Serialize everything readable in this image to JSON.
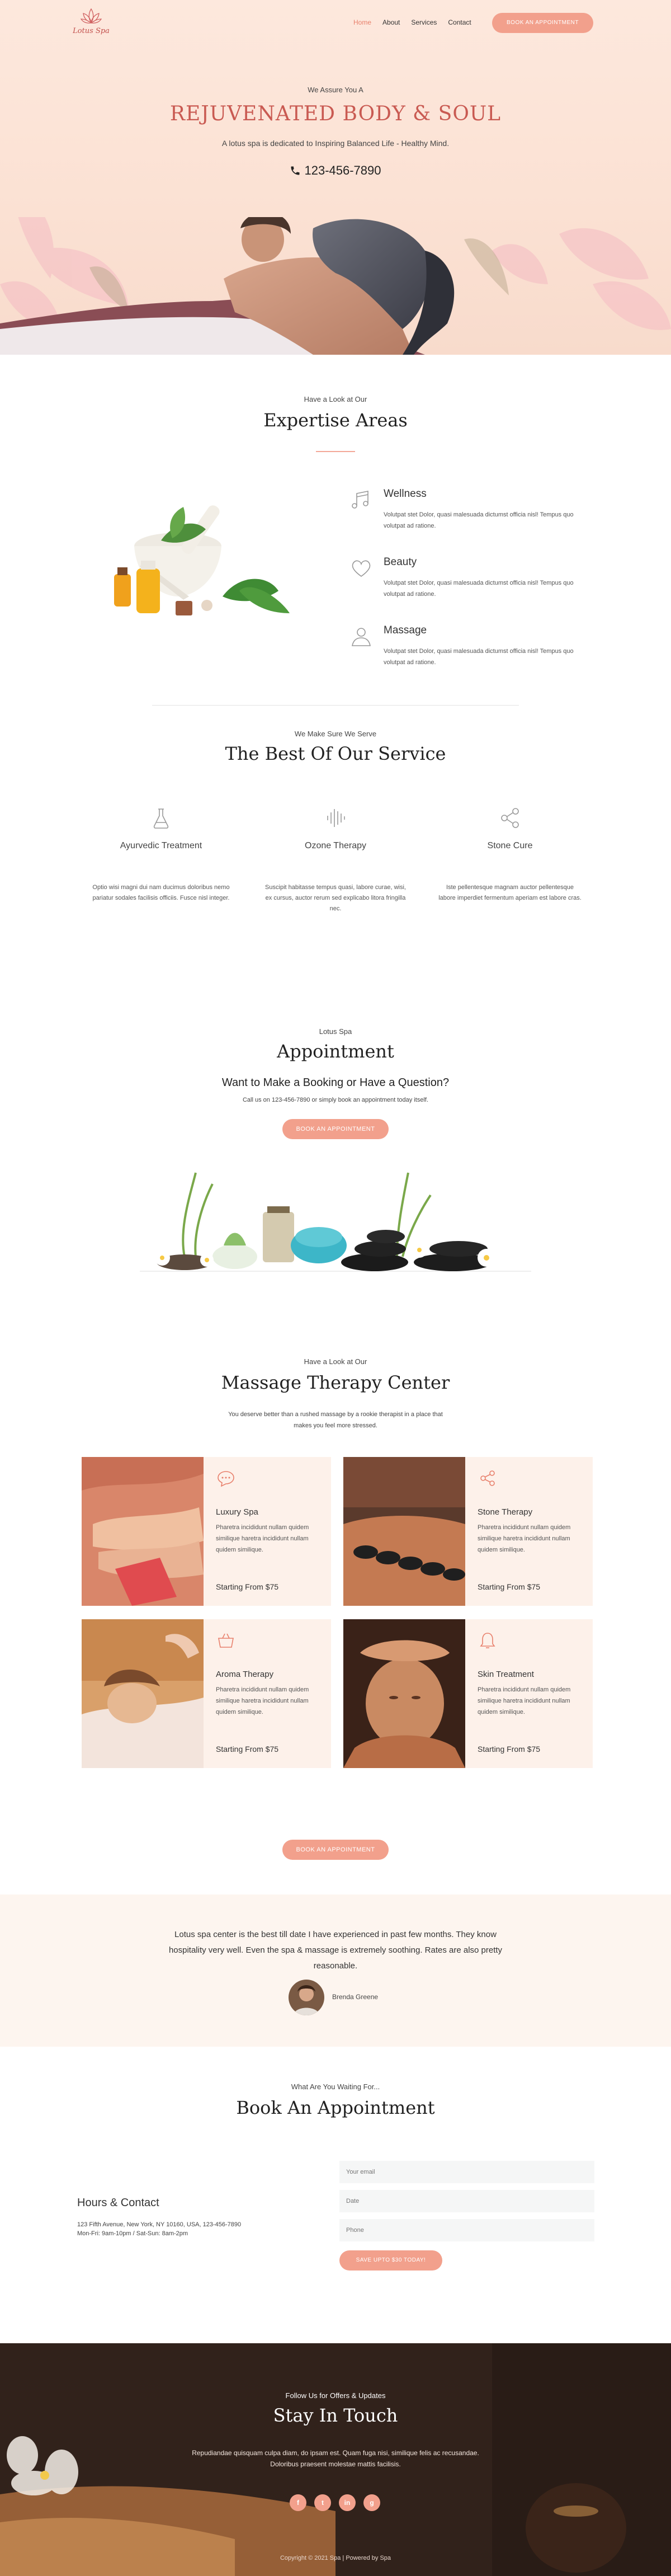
{
  "nav": {
    "logo_text": "Lotus Spa",
    "menu": [
      "Home",
      "About",
      "Services",
      "Contact"
    ],
    "cta": "Book An Appointment"
  },
  "hero": {
    "subtitle": "We Assure You A",
    "title": "REJUVENATED BODY & SOUL",
    "description": "A lotus spa is dedicated to Inspiring Balanced Life - Healthy Mind.",
    "phone": "123-456-7890"
  },
  "expertise": {
    "subtitle": "Have a Look at Our",
    "title": "Expertise Areas",
    "items": [
      {
        "title": "Wellness",
        "icon": "music-note-icon",
        "text": "Volutpat stet Dolor, quasi malesuada dictumst officia nisl! Tempus quo volutpat ad ratione."
      },
      {
        "title": "Beauty",
        "icon": "heart-icon",
        "text": "Volutpat stet Dolor, quasi malesuada dictumst officia nisl! Tempus quo volutpat ad ratione."
      },
      {
        "title": "Massage",
        "icon": "user-icon",
        "text": "Volutpat stet Dolor, quasi malesuada dictumst officia nisl! Tempus quo volutpat ad ratione."
      }
    ]
  },
  "best": {
    "subtitle": "We Make Sure We Serve",
    "title": "The Best Of Our Service",
    "items": [
      {
        "title": "Ayurvedic Treatment",
        "icon": "flask-icon",
        "text": "Optio wisi magni dui nam ducimus doloribus nemo pariatur sodales facilisis officiis. Fusce nisl integer."
      },
      {
        "title": "Ozone Therapy",
        "icon": "soundwave-icon",
        "text": "Suscipit habitasse tempus quasi, labore curae, wisi, ex cursus, auctor rerum sed explicabo litora fringilla nec."
      },
      {
        "title": "Stone Cure",
        "icon": "share-icon",
        "text": "Iste pellentesque magnam auctor pellentesque labore imperdiet fermentum aperiam est labore cras."
      }
    ]
  },
  "appointment": {
    "subtitle": "Lotus Spa",
    "title": "Appointment",
    "question": "Want to Make a Booking or Have a Question?",
    "description": "Call us on 123-456-7890 or simply book an appointment today itself.",
    "cta": "Book An Appointment"
  },
  "massage": {
    "subtitle": "Have a Look at Our",
    "title": "Massage Therapy Center",
    "description_line1": "You deserve better than a rushed massage by a rookie therapist in a place that",
    "description_line2": "makes you feel more stressed.",
    "cards": [
      {
        "title": "Luxury Spa",
        "icon": "chat-icon",
        "text": "Pharetra incididunt nullam quidem similique haretra incididunt nullam quidem similique.",
        "price": "Starting From $75"
      },
      {
        "title": "Stone Therapy",
        "icon": "share-icon",
        "text": "Pharetra incididunt nullam quidem similique haretra incididunt nullam quidem similique.",
        "price": "Starting From $75"
      },
      {
        "title": "Aroma Therapy",
        "icon": "basket-icon",
        "text": "Pharetra incididunt nullam quidem similique haretra incididunt nullam quidem similique.",
        "price": "Starting From $75"
      },
      {
        "title": "Skin Treatment",
        "icon": "bell-icon",
        "text": "Pharetra incididunt nullam quidem similique haretra incididunt nullam quidem similique.",
        "price": "Starting From $75"
      }
    ],
    "cta": "Book An Appointment"
  },
  "testimonial": {
    "quote": "Lotus spa center is the best till date I have experienced in past few months. They know hospitality very well. Even the spa & massage is extremely soothing. Rates are also pretty reasonable.",
    "name": "Brenda Greene"
  },
  "book": {
    "subtitle": "What Are You Waiting For...",
    "title": "Book An Appointment",
    "hours_title": "Hours & Contact",
    "address": "123 Fifth Avenue, New York, NY 10160, USA, 123-456-7890",
    "hours": "Mon-Fri: 9am-10pm / Sat-Sun: 8am-2pm",
    "placeholders": {
      "name": "Your email",
      "date": "Date",
      "phone": "Phone"
    },
    "submit": "Save Upto $30 Today!"
  },
  "footer": {
    "subtitle": "Follow Us for Offers & Updates",
    "title": "Stay In Touch",
    "description": "Repudiandae quisquam culpa diam, do ipsam est. Quam fuga nisi, similique felis ac recusandae. Doloribus praesent molestae mattis facilisis.",
    "socials": [
      "f",
      "t",
      "in",
      "g"
    ],
    "copyright": "Copyright © 2021 Spa | Powered by Spa"
  },
  "colors": {
    "accent": "#f2a08c",
    "title_red": "#c95a52",
    "card_bg": "#fdf1ea"
  }
}
